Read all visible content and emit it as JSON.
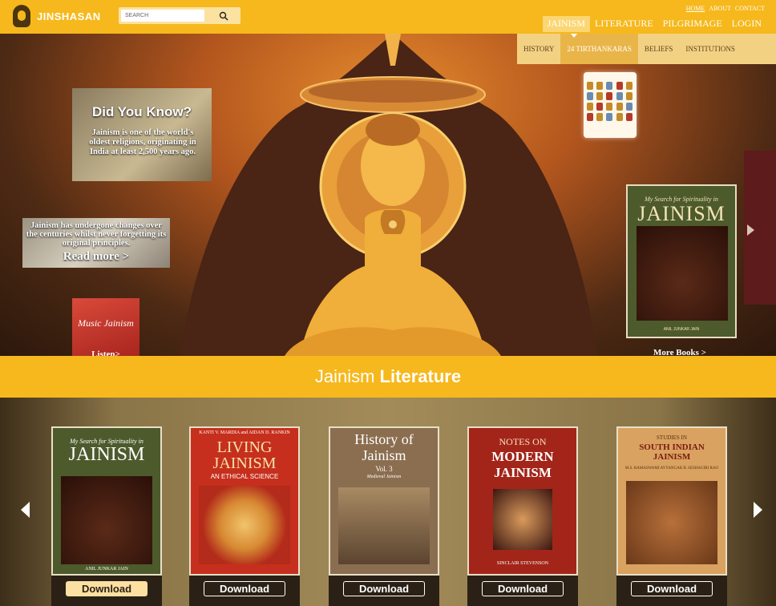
{
  "header": {
    "logo_text": "JINSHASAN",
    "search_placeholder": "SEARCH",
    "utility_links": [
      "HOME",
      "ABOUT",
      "CONTACT"
    ],
    "nav_items": [
      "JAINISM",
      "LITERATURE",
      "PILGRIMAGE",
      "LOGIN"
    ],
    "active_nav": "JAINISM",
    "sub_items": [
      "HISTORY",
      "24 TIRTHANKARAS",
      "BELIEFS",
      "INSTITUTIONS"
    ],
    "active_sub": "24 TIRTHANKARAS"
  },
  "hero": {
    "did_you_know": {
      "title": "Did You Know?",
      "text": "Jainism is one of the world's oldest religions, originating in India at least 2,500 years ago."
    },
    "history_card": {
      "text": "Jainism has undergone changes over the centuries whilst never forgetting its original principles.",
      "link": "Read more >"
    },
    "music_card": {
      "title": "Music Jainism",
      "link": "Listen>"
    },
    "featured_book": {
      "subtitle": "My Search for Spirituality in",
      "title": "JAINISM",
      "author": "ANIL JUNKAR JAIN"
    },
    "more_books": "More Books >"
  },
  "literature": {
    "title_light": "Jainism",
    "title_bold": "Literature",
    "download_label": "Download",
    "books": [
      {
        "top": "My Search for Spirituality in",
        "title": "JAINISM",
        "author": "ANIL JUNKAR JAIN",
        "bg": "#4d5a2c"
      },
      {
        "top": "KANTI V. MARDIA and AIDAN D. RANKIN",
        "title": "LIVING JAINISM",
        "subtitle": "AN ETHICAL SCIENCE",
        "bg": "#c62f1d"
      },
      {
        "top": "History of Jainism",
        "title": "Vol. 3",
        "subtitle": "Medieval Jainism",
        "bg": "#8b6e50"
      },
      {
        "top": "NOTES ON",
        "title": "MODERN JAINISM",
        "author": "SINCLAIR STEVENSON",
        "bg": "#a32519"
      },
      {
        "top": "STUDIES IN",
        "title": "SOUTH INDIAN JAINISM",
        "subtitle": "M.S. RAMASWAMI AYYANGAR B. SESHAGIRI RAO",
        "bg": "#d9a261"
      }
    ]
  }
}
